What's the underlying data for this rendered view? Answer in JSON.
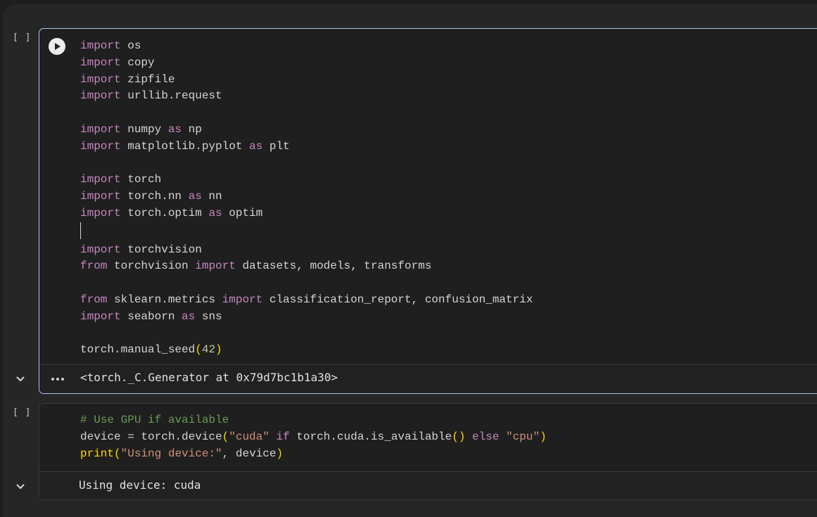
{
  "cells": [
    {
      "exec_label": "[ ]",
      "code_lines": [
        [
          {
            "t": "import",
            "c": "k"
          },
          {
            "t": " os",
            "c": ""
          }
        ],
        [
          {
            "t": "import",
            "c": "k"
          },
          {
            "t": " copy",
            "c": ""
          }
        ],
        [
          {
            "t": "import",
            "c": "k"
          },
          {
            "t": " zipfile",
            "c": ""
          }
        ],
        [
          {
            "t": "import",
            "c": "k"
          },
          {
            "t": " urllib.request",
            "c": ""
          }
        ],
        [],
        [
          {
            "t": "import",
            "c": "k"
          },
          {
            "t": " numpy ",
            "c": ""
          },
          {
            "t": "as",
            "c": "k"
          },
          {
            "t": " np",
            "c": ""
          }
        ],
        [
          {
            "t": "import",
            "c": "k"
          },
          {
            "t": " matplotlib.pyplot ",
            "c": ""
          },
          {
            "t": "as",
            "c": "k"
          },
          {
            "t": " plt",
            "c": ""
          }
        ],
        [],
        [
          {
            "t": "import",
            "c": "k"
          },
          {
            "t": " torch",
            "c": ""
          }
        ],
        [
          {
            "t": "import",
            "c": "k"
          },
          {
            "t": " torch.nn ",
            "c": ""
          },
          {
            "t": "as",
            "c": "k"
          },
          {
            "t": " nn",
            "c": ""
          }
        ],
        [
          {
            "t": "import",
            "c": "k"
          },
          {
            "t": " torch.optim ",
            "c": ""
          },
          {
            "t": "as",
            "c": "k"
          },
          {
            "t": " optim",
            "c": ""
          }
        ],
        [
          {
            "t": "",
            "c": "caret"
          }
        ],
        [
          {
            "t": "import",
            "c": "k"
          },
          {
            "t": " torchvision",
            "c": ""
          }
        ],
        [
          {
            "t": "from",
            "c": "k"
          },
          {
            "t": " torchvision ",
            "c": ""
          },
          {
            "t": "import",
            "c": "k"
          },
          {
            "t": " datasets, models, transforms",
            "c": ""
          }
        ],
        [],
        [
          {
            "t": "from",
            "c": "k"
          },
          {
            "t": " sklearn.metrics ",
            "c": ""
          },
          {
            "t": "import",
            "c": "k"
          },
          {
            "t": " classification_report, confusion_matrix",
            "c": ""
          }
        ],
        [
          {
            "t": "import",
            "c": "k"
          },
          {
            "t": " seaborn ",
            "c": ""
          },
          {
            "t": "as",
            "c": "k"
          },
          {
            "t": " sns",
            "c": ""
          }
        ],
        [],
        [
          {
            "t": "torch.manual_seed",
            "c": ""
          },
          {
            "t": "(",
            "c": "p"
          },
          {
            "t": "42",
            "c": "n"
          },
          {
            "t": ")",
            "c": "p"
          }
        ]
      ],
      "output": "<torch._C.Generator at 0x79d7bc1b1a30>"
    },
    {
      "exec_label": "[ ]",
      "code_lines": [
        [
          {
            "t": "# Use GPU if available",
            "c": "c"
          }
        ],
        [
          {
            "t": "device = torch.device",
            "c": ""
          },
          {
            "t": "(",
            "c": "p"
          },
          {
            "t": "\"cuda\"",
            "c": "s"
          },
          {
            "t": " ",
            "c": ""
          },
          {
            "t": "if",
            "c": "k"
          },
          {
            "t": " torch.cuda.is_available",
            "c": ""
          },
          {
            "t": "()",
            "c": "p"
          },
          {
            "t": " ",
            "c": ""
          },
          {
            "t": "else",
            "c": "k"
          },
          {
            "t": " ",
            "c": ""
          },
          {
            "t": "\"cpu\"",
            "c": "s"
          },
          {
            "t": ")",
            "c": "p"
          }
        ],
        [
          {
            "t": "print",
            "c": "p"
          },
          {
            "t": "(",
            "c": "p"
          },
          {
            "t": "\"Using device:\"",
            "c": "s"
          },
          {
            "t": ", device",
            "c": ""
          },
          {
            "t": ")",
            "c": "p"
          }
        ]
      ],
      "output": "Using device: cuda"
    }
  ],
  "icons": {
    "run": "play-icon",
    "collapse": "chevron-down-icon",
    "more": "more-dots-icon"
  }
}
